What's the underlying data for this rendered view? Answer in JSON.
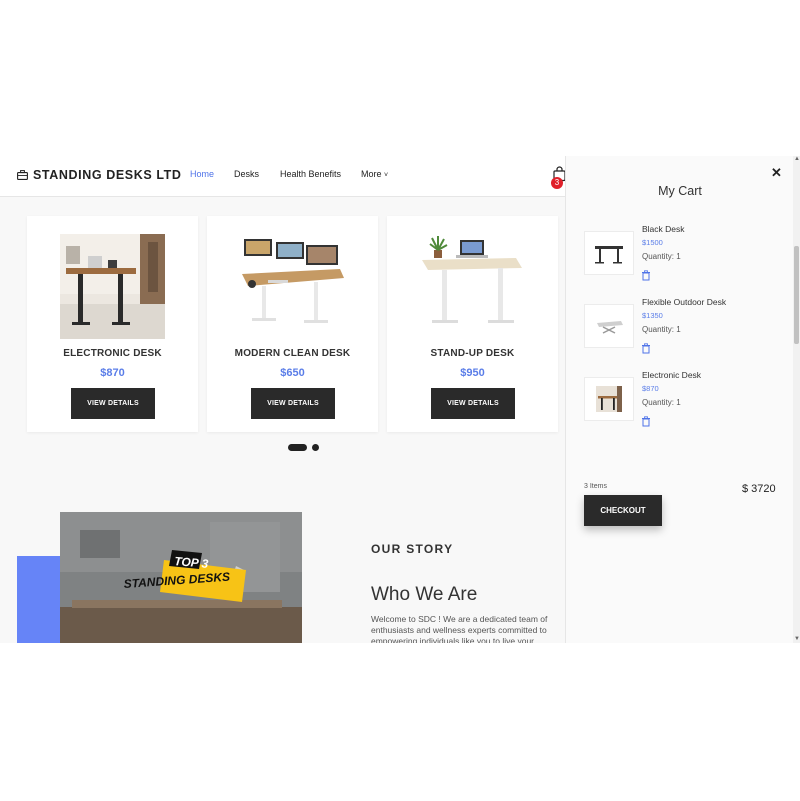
{
  "brand": {
    "name": "STANDING DESKS LTD",
    "icon": "briefcase-icon"
  },
  "nav": {
    "links": [
      {
        "label": "Home",
        "active": true
      },
      {
        "label": "Desks",
        "active": false
      },
      {
        "label": "Health Benefits",
        "active": false
      },
      {
        "label": "More",
        "active": false
      }
    ],
    "more_chevron": "˅",
    "cart_icon": "shopping-bag-icon",
    "cart_badge": "3"
  },
  "products": [
    {
      "name": "ELECTRONIC DESK",
      "price": "$870",
      "button": "VIEW DETAILS"
    },
    {
      "name": "MODERN CLEAN DESK",
      "price": "$650",
      "button": "VIEW DETAILS"
    },
    {
      "name": "STAND-UP DESK",
      "price": "$950",
      "button": "VIEW DETAILS"
    }
  ],
  "carousel": {
    "pages": 2,
    "active": 1
  },
  "story": {
    "image_text": {
      "line1": "TOP 3",
      "line2": "STANDING DESKS"
    },
    "label": "OUR STORY",
    "title": "Who We Are",
    "text": "Welcome to SDC ! We are a dedicated team of enthusiasts and wellness experts committed to empowering individuals like you to live your"
  },
  "cart": {
    "title": "My Cart",
    "close": "✕",
    "items": [
      {
        "name": "Black Desk",
        "price": "$1500",
        "quantity": "Quantity: 1"
      },
      {
        "name": "Flexible Outdoor Desk",
        "price": "$1350",
        "quantity": "Quantity: 1"
      },
      {
        "name": "Electronic Desk",
        "price": "$870",
        "quantity": "Quantity: 1"
      }
    ],
    "count": "3 Items",
    "total": "$ 3720",
    "checkout": "CHECKOUT"
  },
  "colors": {
    "accent": "#4f73e8",
    "price": "#5a7de8",
    "button": "#2a2a2a",
    "badge": "#e0202a",
    "story_block": "#6684f7",
    "banner": "#f7c316"
  }
}
